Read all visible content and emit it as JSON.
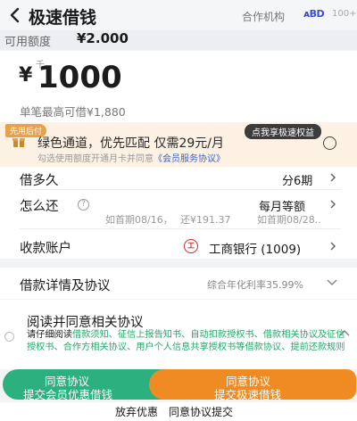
{
  "header": {
    "title": "极速借钱",
    "partner_label": "合作机构",
    "partner_logo": "ᴀBD",
    "partner_count": "100+"
  },
  "credit": {
    "label": "可用额度",
    "value": "¥2.000"
  },
  "amount": {
    "currency": "¥",
    "unit_hint": "千",
    "value": "1000",
    "max_text": "单笔最高可借¥1,880"
  },
  "promo": {
    "tag": "先用后付",
    "badge": "点我享极速权益",
    "main_1": "绿色通道，优先匹配  仅需",
    "main_price": "29",
    "main_2": "元/月",
    "sub_prefix": "勾选使用额度开通月卡并同意",
    "sub_link": "《会员服务协议》"
  },
  "loan": {
    "term_label": "借多久",
    "term_value": "分6期",
    "repay_label": "怎么还",
    "repay_value": "每月等额",
    "first_date": "如首期08/16，",
    "first_amount": "还¥191.37",
    "first_right": "如首期08/28..",
    "account_label": "收款账户",
    "bank_icon": "工",
    "account_value": "工商银行 (1009)"
  },
  "agreement": {
    "label": "借款详情及协议",
    "rate_text": "综合年化利率35.99%"
  },
  "read": {
    "title": "阅读并同意相关协议",
    "lead": "请仔细阅读",
    "g1": "借款须知、征信上报告知书、",
    "g2": "自动扣款授权书、借款相关协议及征信授权书、合作方相关协议、用户个人信息共享授权书等借款协议、提前还款规则"
  },
  "buttons": {
    "left_line1": "同意协议",
    "left_line2": "提交会员优惠借钱",
    "right_line1": "同意协议",
    "right_line2": "提交极速借钱"
  },
  "bottom": {
    "giveup": "放弃优惠",
    "agree": "同意协议提交"
  },
  "colors": {
    "green": "#2bb07e",
    "orange": "#f08a22",
    "promo_bg": "#fdf1e4",
    "link_blue": "#3b63c9"
  }
}
